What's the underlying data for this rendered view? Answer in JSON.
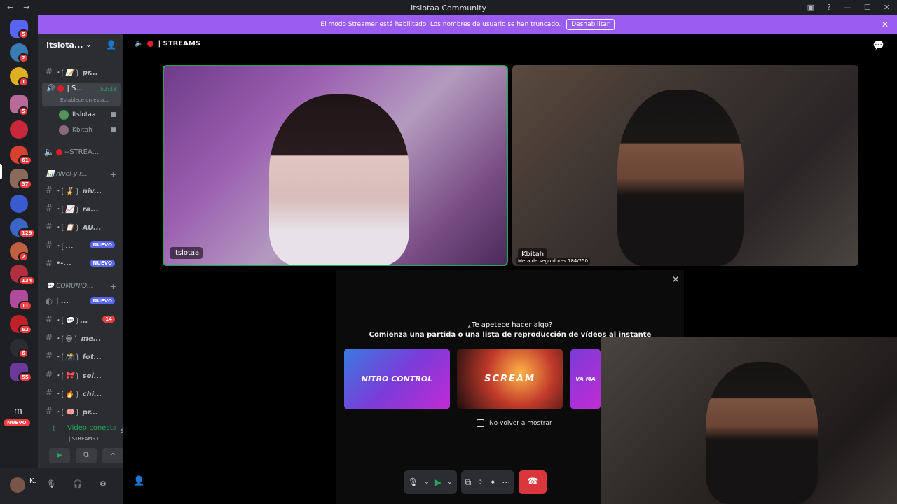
{
  "window": {
    "title": "Itslotaa Community",
    "back": "←",
    "forward": "→",
    "inbox_icon": "▣",
    "help_icon": "?",
    "minimize": "—",
    "maximize": "☐",
    "close": "✕"
  },
  "banner": {
    "text": "El modo Streamer está habilitado. Los nombres de usuario se han truncado.",
    "button": "Deshabilitar",
    "close": "✕"
  },
  "rail": {
    "badges": [
      "5",
      "2",
      "1",
      "5",
      "61",
      "37",
      "129",
      "2",
      "134",
      "11",
      "62",
      "6",
      "55"
    ],
    "letter": "m",
    "new_badge": "NUEVO"
  },
  "server": {
    "name": "Itslota...",
    "caret": "⌄",
    "invite_icon": "👤"
  },
  "channels": {
    "c1": {
      "hash": "#",
      "name": "･❲📝❳ pr..."
    },
    "active_voice": {
      "name": "| S...",
      "time": "52:33",
      "status": "Establece un esta..."
    },
    "voice_users": [
      {
        "name": "Itslotaa"
      },
      {
        "name": "Kbitah"
      }
    ],
    "voice2": {
      "name": "--STREA..."
    },
    "cat1": {
      "name": "📊 nivel-y-r...",
      "plus": "+"
    },
    "list1": [
      {
        "hash": "#",
        "name": "･❲🎖️❳ niv..."
      },
      {
        "hash": "#",
        "name": "･❲📈❳ ra..."
      },
      {
        "hash": "#",
        "name": "･❲📋❳ AU..."
      },
      {
        "hash": "#",
        "name": "･❲...",
        "badge": "NUEVO"
      },
      {
        "hash": "#",
        "name": "•-...",
        "badge": "NUEVO"
      }
    ],
    "cat2": {
      "name": "💬 COMUNID...",
      "plus": "+"
    },
    "forum": {
      "name": "| ...",
      "badge": "NUEVO"
    },
    "list2": [
      {
        "hash": "#",
        "name": "･❲💬❳...",
        "badge": "14"
      },
      {
        "hash": "#",
        "name": "･❲😆❳ me..."
      },
      {
        "hash": "#",
        "name": "･❲📸❳ fot..."
      },
      {
        "hash": "#",
        "name": "･❲🎀❳ sel..."
      },
      {
        "hash": "#",
        "name": "･❲🔥❳ chi..."
      },
      {
        "hash": "#",
        "name": "･❲🧠❳ pr..."
      }
    ]
  },
  "voice_panel": {
    "status": "Video conecta",
    "channel": "| STREAMS / ...",
    "waveform_icon": "≋",
    "disconnect_icon": "☎",
    "camera_icon": "▶",
    "screen_icon": "⧉",
    "activity_icon": "⁘",
    "soundboard_icon": "✦"
  },
  "user": {
    "name": "K.",
    "mic": "🎙",
    "headset": "🎧",
    "settings": "⚙"
  },
  "main": {
    "channel_title": "| STREAMS",
    "speaker_icon": "🔈",
    "chat_icon": "💬",
    "tiles": [
      {
        "name": "Itslotaa"
      },
      {
        "name": "Kbitah",
        "overlay_text": "Meta de seguidores 184/250"
      }
    ],
    "activity": {
      "q1": "¿Te apetece hacer algo?",
      "q2": "Comienza una partida o una lista de reproducción de vídeos al instante",
      "cards": [
        "NITRO CONTROL",
        "SCREAM",
        "VA MA"
      ],
      "checkbox": "No volver a mostrar",
      "close": "✕"
    },
    "controls": {
      "mic": "🎙",
      "cam": "▶",
      "chev": "⌄",
      "screen": "⧉",
      "activities": "⁘",
      "soundboard": "✦",
      "more": "⋯",
      "leave": "☎"
    },
    "add_user_icon": "👤"
  }
}
